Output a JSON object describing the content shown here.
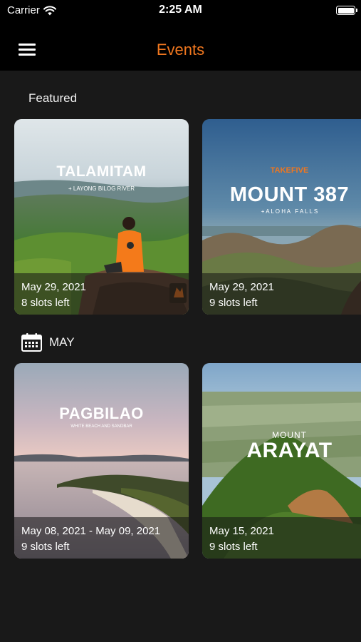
{
  "status_bar": {
    "carrier": "Carrier",
    "time": "2:25 AM",
    "wifi_icon": "wifi-icon",
    "battery_icon": "battery-icon"
  },
  "nav": {
    "title": "Events",
    "menu_icon": "menu-icon",
    "title_color": "#f0771f"
  },
  "featured": {
    "label": "Featured",
    "cards": [
      {
        "image_title": "TALAMITAM",
        "image_subtitle": "+ LAYONG BILOG RIVER",
        "date": "May 29, 2021",
        "slots": "8 slots left"
      },
      {
        "image_logo": "TAKEFIVE",
        "image_title": "MOUNT 387",
        "image_subtitle": "+ A L O H A   F A L L S",
        "date": "May 29, 2021",
        "slots": "9 slots left"
      }
    ]
  },
  "month_section": {
    "label": "MAY",
    "icon": "calendar-icon",
    "cards": [
      {
        "image_title": "PAGBILAO",
        "image_subtitle": "WHITE BEACH AND SANDBAR",
        "date": "May 08, 2021 - May 09, 2021",
        "slots": "9 slots left"
      },
      {
        "image_pretitle": "MOUNT",
        "image_title": "ARAYAT",
        "date": "May 15, 2021",
        "slots": "9 slots left"
      }
    ]
  }
}
